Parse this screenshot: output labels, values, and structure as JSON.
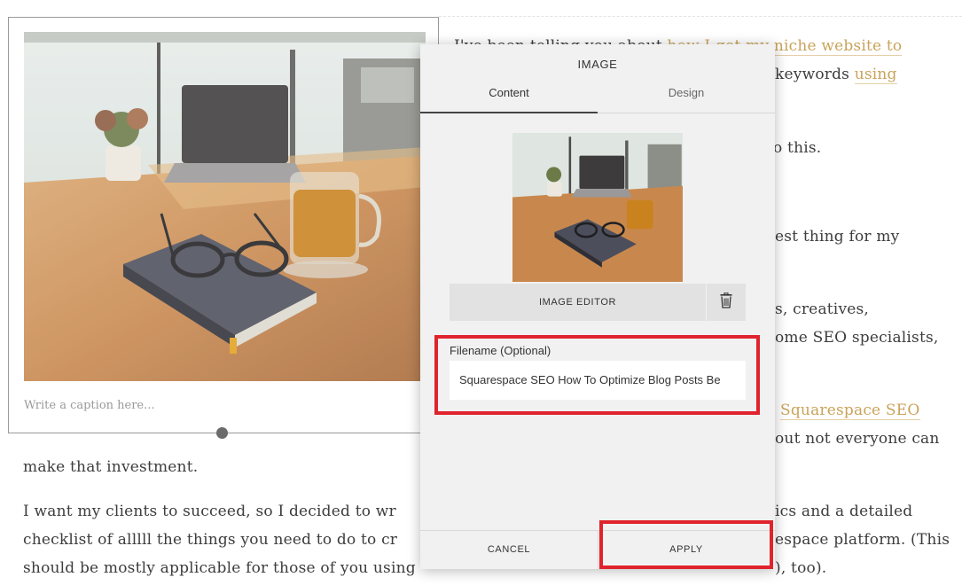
{
  "article": {
    "line1_start": "I've been telling you about ",
    "line1_link": "how I got my niche website to",
    "line2_tail": "keywords ",
    "line2_link": "using",
    "line3_tail": "o this.",
    "line4_tail": "est thing for my",
    "line5_tail": "s, creatives,",
    "line6_tail": "ome SEO specialists,",
    "line7_link": "Squarespace SEO",
    "line8_tail": "out not everyone can",
    "line9": "make that investment.",
    "line10_start": "I want my clients to succeed, so I decided to wr",
    "line10_tail": "ics and a detailed",
    "line11_start": "checklist of alllll the things you need to do to cr",
    "line11_tail": "espace platform. (This",
    "line12_start": "should be mostly applicable for those of you using",
    "line12_tail": "), too)."
  },
  "image_block": {
    "caption_placeholder": "Write a caption here..."
  },
  "dialog": {
    "title": "IMAGE",
    "tabs": [
      "Content",
      "Design"
    ],
    "active_tab": "Content",
    "image_editor_label": "IMAGE EDITOR",
    "filename_label": "Filename (Optional)",
    "filename_value": "Squarespace SEO How To Optimize Blog Posts Be",
    "cancel_label": "CANCEL",
    "apply_label": "APPLY"
  },
  "icons": {
    "trash": "trash-icon"
  },
  "colors": {
    "link": "#c9a35a",
    "highlight": "#e0232d",
    "dialog_bg": "#f1f1f1"
  }
}
